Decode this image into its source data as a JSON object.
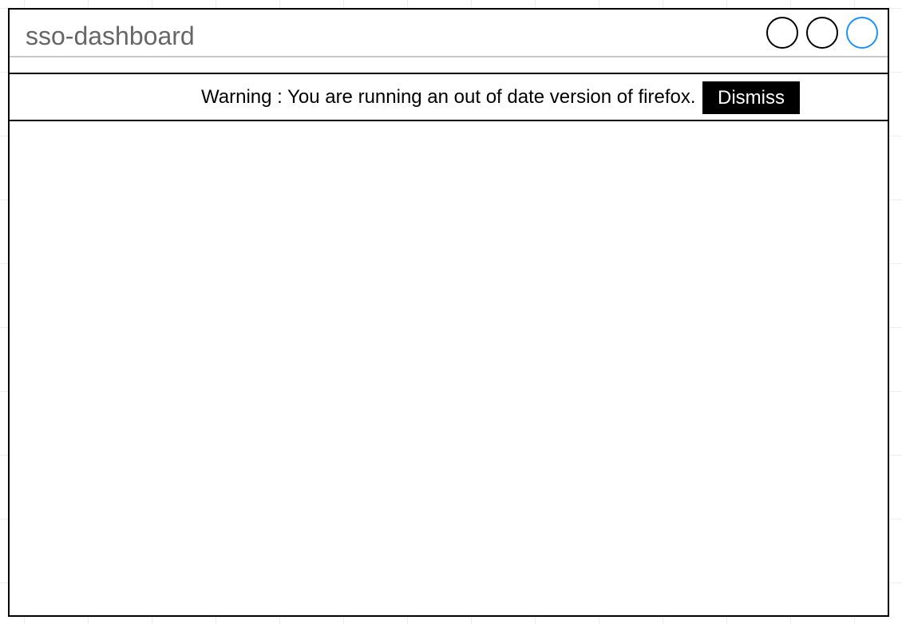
{
  "window": {
    "title": "sso-dashboard",
    "controls": [
      {
        "name": "window-control",
        "color": "#000000"
      },
      {
        "name": "window-control",
        "color": "#000000"
      },
      {
        "name": "window-control",
        "color": "#1e90ff"
      }
    ]
  },
  "warning": {
    "message": "Warning : You are running an out of date version of firefox.",
    "dismiss_label": "Dismiss"
  },
  "colors": {
    "title_text": "#666666",
    "border": "#000000",
    "dismiss_bg": "#000000",
    "dismiss_text": "#ffffff",
    "accent": "#1e90ff"
  }
}
